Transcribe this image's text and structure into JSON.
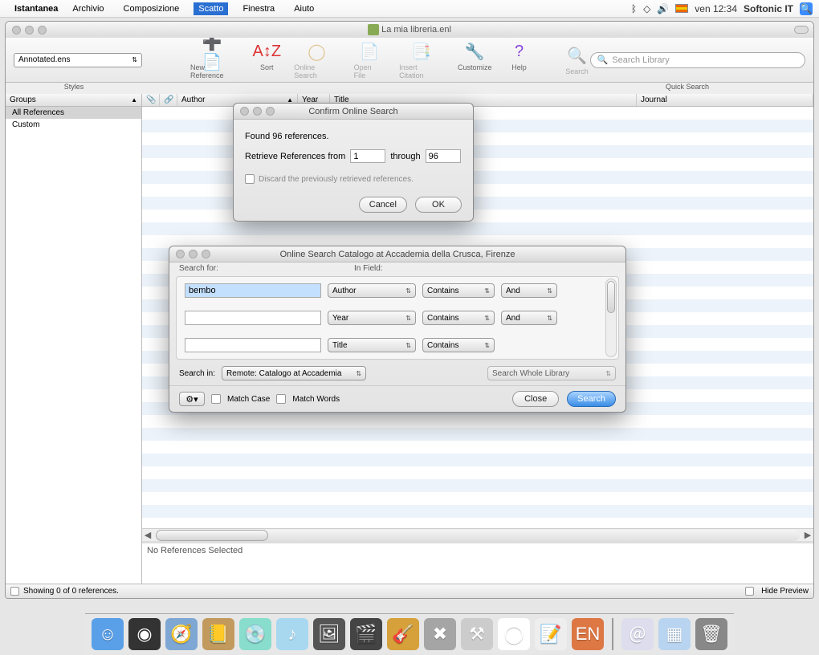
{
  "menubar": {
    "apple": "",
    "app": "Istantanea",
    "items": [
      "Archivio",
      "Composizione",
      "Scatto",
      "Finestra",
      "Aiuto"
    ],
    "active_index": 2,
    "clock": "ven 12:34",
    "user": "Softonic IT"
  },
  "window": {
    "title": "La mia libreria.enl",
    "style_selected": "Annotated.ens",
    "styles_label": "Styles",
    "quick_label": "Quick Search",
    "search_placeholder": "Search Library"
  },
  "toolbar": {
    "new_ref": "New Reference",
    "sort": "Sort",
    "online_search": "Online Search",
    "open_file": "Open File",
    "insert_citation": "Insert Citation",
    "customize": "Customize",
    "help": "Help",
    "search": "Search"
  },
  "groups": {
    "header": "Groups",
    "items": [
      "All References",
      "Custom"
    ]
  },
  "ref_list": {
    "columns": {
      "author": "Author",
      "year": "Year",
      "title": "Title",
      "journal": "Journal"
    },
    "no_selection": "No References Selected"
  },
  "status": {
    "showing": "Showing 0 of 0 references.",
    "hide_preview": "Hide Preview"
  },
  "confirm_dialog": {
    "title": "Confirm Online Search",
    "found": "Found 96 references.",
    "retrieve_label": "Retrieve References from",
    "through": "through",
    "from_val": "1",
    "to_val": "96",
    "discard": "Discard the previously retrieved references.",
    "cancel": "Cancel",
    "ok": "OK"
  },
  "search_dialog": {
    "title": "Online Search Catalogo at Accademia della Crusca, Firenze",
    "search_for": "Search for:",
    "in_field": "In Field:",
    "row1_val": "bembo",
    "row2_val": "",
    "row3_val": "",
    "field_author": "Author",
    "field_year": "Year",
    "field_title": "Title",
    "op_contains": "Contains",
    "conj_and": "And",
    "search_in_label": "Search in:",
    "search_in_value": "Remote: Catalogo at Accademia",
    "whole_library": "Search Whole Library",
    "match_case": "Match Case",
    "match_words": "Match Words",
    "close": "Close",
    "search": "Search"
  },
  "dock": {
    "items": [
      {
        "name": "finder",
        "bg": "#5aa0e8",
        "glyph": "☺"
      },
      {
        "name": "dashboard",
        "bg": "#333",
        "glyph": "◉"
      },
      {
        "name": "safari",
        "bg": "#7ea7d4",
        "glyph": "🧭"
      },
      {
        "name": "addressbook",
        "bg": "#c29a5e",
        "glyph": "📒"
      },
      {
        "name": "cd",
        "bg": "#8dc",
        "glyph": "💿"
      },
      {
        "name": "itunes",
        "bg": "#a8d8f0",
        "glyph": "♪"
      },
      {
        "name": "iphoto",
        "bg": "#555",
        "glyph": "🖼"
      },
      {
        "name": "imovie",
        "bg": "#444",
        "glyph": "🎬"
      },
      {
        "name": "garageband",
        "bg": "#d6a03a",
        "glyph": "🎸"
      },
      {
        "name": "utility",
        "bg": "#a5a5a5",
        "glyph": "✖"
      },
      {
        "name": "xcode",
        "bg": "#ccc",
        "glyph": "⚒"
      },
      {
        "name": "swirl",
        "bg": "#fff",
        "glyph": "◯"
      },
      {
        "name": "textedit",
        "bg": "#eee",
        "glyph": "📝"
      },
      {
        "name": "endnote",
        "bg": "#d74",
        "glyph": "EN"
      }
    ],
    "right": [
      {
        "name": "mail-stack",
        "bg": "#dde",
        "glyph": "＠"
      },
      {
        "name": "doc",
        "bg": "#b8d4f0",
        "glyph": "▦"
      },
      {
        "name": "trash",
        "bg": "#888",
        "glyph": "🗑"
      }
    ]
  }
}
